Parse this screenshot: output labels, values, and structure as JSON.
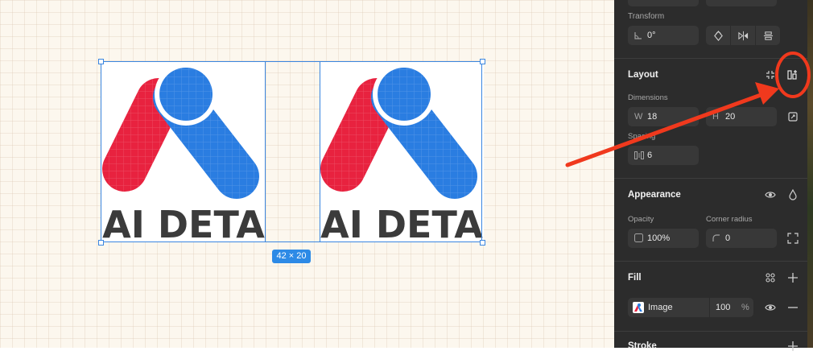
{
  "canvas": {
    "logo_text": "AI DETA",
    "selection_size": "42 × 20",
    "colors": {
      "logo_red": "#e8223f",
      "logo_blue": "#2a7de1",
      "logo_text": "#3b3b3b",
      "selection": "#3a86e0"
    }
  },
  "panel": {
    "transform": {
      "title": "Transform",
      "rotation_value": "0°",
      "icons": [
        "rotate-icon",
        "flip-horizontal-icon",
        "align-vertical-center-icon"
      ]
    },
    "layout": {
      "title": "Layout",
      "dimensions_label": "Dimensions",
      "width_prefix": "W",
      "width_value": "18",
      "height_prefix": "H",
      "height_value": "20",
      "spacing_label": "Spacing",
      "spacing_value": "6"
    },
    "appearance": {
      "title": "Appearance",
      "opacity_label": "Opacity",
      "opacity_value": "100%",
      "corner_label": "Corner radius",
      "corner_value": "0"
    },
    "fill": {
      "title": "Fill",
      "type_label": "Image",
      "opacity_value": "100",
      "percent_sign": "%"
    },
    "stroke": {
      "title": "Stroke"
    }
  },
  "annotation": {
    "color": "#f0391d",
    "target": "add-auto-layout-button"
  }
}
